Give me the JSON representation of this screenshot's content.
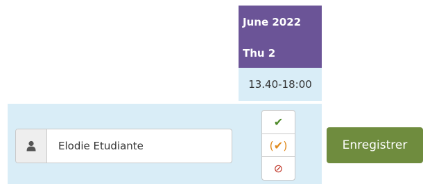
{
  "poll": {
    "month": "June 2022",
    "day": "Thu 2",
    "time": "13.40-18:00"
  },
  "participant": {
    "icon": "user-icon",
    "name": "Elodie Etudiante"
  },
  "choices": {
    "yes": "✔",
    "maybe": "(✔)",
    "no": "⊘"
  },
  "actions": {
    "save_label": "Enregistrer"
  },
  "colors": {
    "header": "#6b5497",
    "row": "#d9edf7",
    "save_button": "#6f8c3e",
    "yes": "#4f8a2a",
    "maybe": "#e08a1e",
    "no": "#c0392b"
  }
}
